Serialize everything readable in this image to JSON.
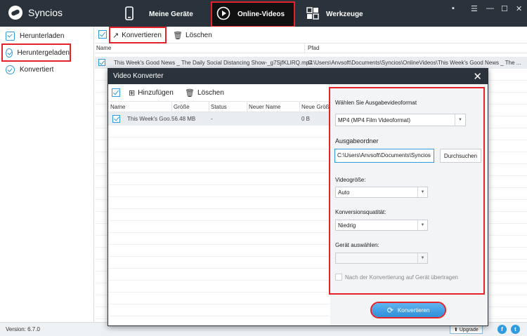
{
  "app": {
    "name": "Syncios"
  },
  "nav": {
    "tabs": [
      {
        "label": "Meine Geräte",
        "icon": "phone-icon"
      },
      {
        "label": "Online-Videos",
        "icon": "play-icon"
      },
      {
        "label": "Werkzeuge",
        "icon": "tools-icon"
      }
    ],
    "window_controls": [
      "chat-icon",
      "menu-icon",
      "minimize-icon",
      "maximize-icon",
      "close-icon"
    ]
  },
  "sidebar": {
    "items": [
      {
        "label": "Herunterladen",
        "icon": "download-icon"
      },
      {
        "label": "Heruntergeladen",
        "icon": "check-circle-icon"
      },
      {
        "label": "Konvertiert",
        "icon": "check-circle-icon"
      }
    ]
  },
  "toolbar": {
    "convert_label": "Konvertieren",
    "delete_label": "Löschen"
  },
  "file_table": {
    "columns": [
      "Name",
      "Pfad"
    ],
    "rows": [
      {
        "name": "This Week's Good News _ The Daily Social Distancing Show-_g7SjfKLIRQ.mp4",
        "path": "C:\\Users\\Anvsoft\\Documents\\Syncios\\OnlineVideos\\This Week's Good News _ The ..."
      }
    ]
  },
  "dialog": {
    "title": "Video Konverter",
    "toolbar": {
      "add_label": "Hinzufügen",
      "delete_label": "Löschen"
    },
    "columns": [
      "Name",
      "Größe",
      "Status",
      "Neuer Name",
      "Neue Größ"
    ],
    "rows": [
      {
        "name": "This Week's Goo...",
        "size": "56.48 MB",
        "status": "-",
        "new_name": "",
        "new_size": "0 B"
      }
    ],
    "settings": {
      "format_label": "Wählen Sie Ausgabevideoformat",
      "format_value": "MP4 (MP4 Film Videoformat)",
      "folder_label": "Ausgabeordner",
      "folder_value": "C:\\Users\\Anvsoft\\Documents\\Syncios",
      "browse_label": "Durchsuchen",
      "size_label": "Videogröße:",
      "size_value": "Auto",
      "quality_label": "Konversionsquatität:",
      "quality_value": "Niedrig",
      "device_label": "Gerät auswählen:",
      "device_value": "",
      "transfer_label": "Nach der Konvertierung auf Gerät übertragen"
    },
    "convert_label": "Konvertieren"
  },
  "status": {
    "version": "Version: 6.7.0",
    "upgrade_label": "Upgrade",
    "social": [
      "f",
      "t"
    ]
  },
  "colors": {
    "titlebar": "#2a333c",
    "accent": "#2f9be0",
    "highlight": "#e3222a"
  }
}
